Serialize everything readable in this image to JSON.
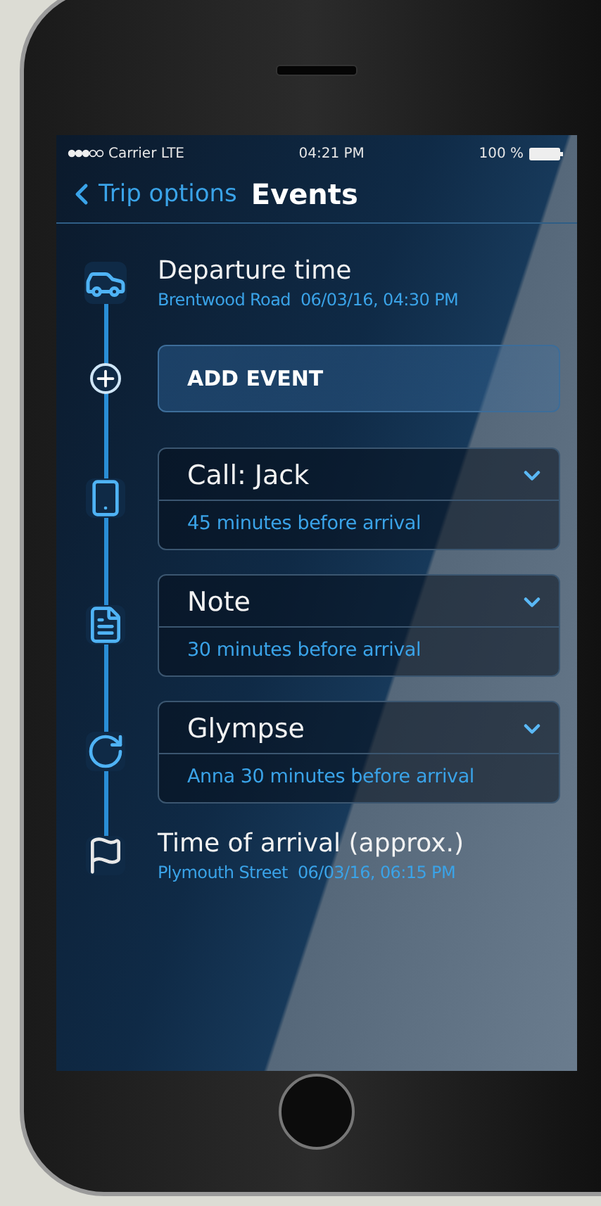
{
  "status_bar": {
    "carrier": "Carrier LTE",
    "time": "04:21 PM",
    "battery": "100 %"
  },
  "nav": {
    "back": "Trip options",
    "title": "Events"
  },
  "departure": {
    "title": "Departure time",
    "place": "Brentwood Road",
    "datetime": "06/03/16, 04:30 PM"
  },
  "add_event": {
    "label": "ADD EVENT"
  },
  "events": [
    {
      "title": "Call: Jack",
      "detail": "45 minutes before arrival"
    },
    {
      "title": "Note",
      "detail": "30 minutes before arrival"
    },
    {
      "title": "Glympse",
      "detail": "Anna 30 minutes before arrival"
    }
  ],
  "arrival": {
    "title": "Time of arrival (approx.)",
    "place": "Plymouth Street",
    "datetime": "06/03/16, 06:15 PM"
  }
}
